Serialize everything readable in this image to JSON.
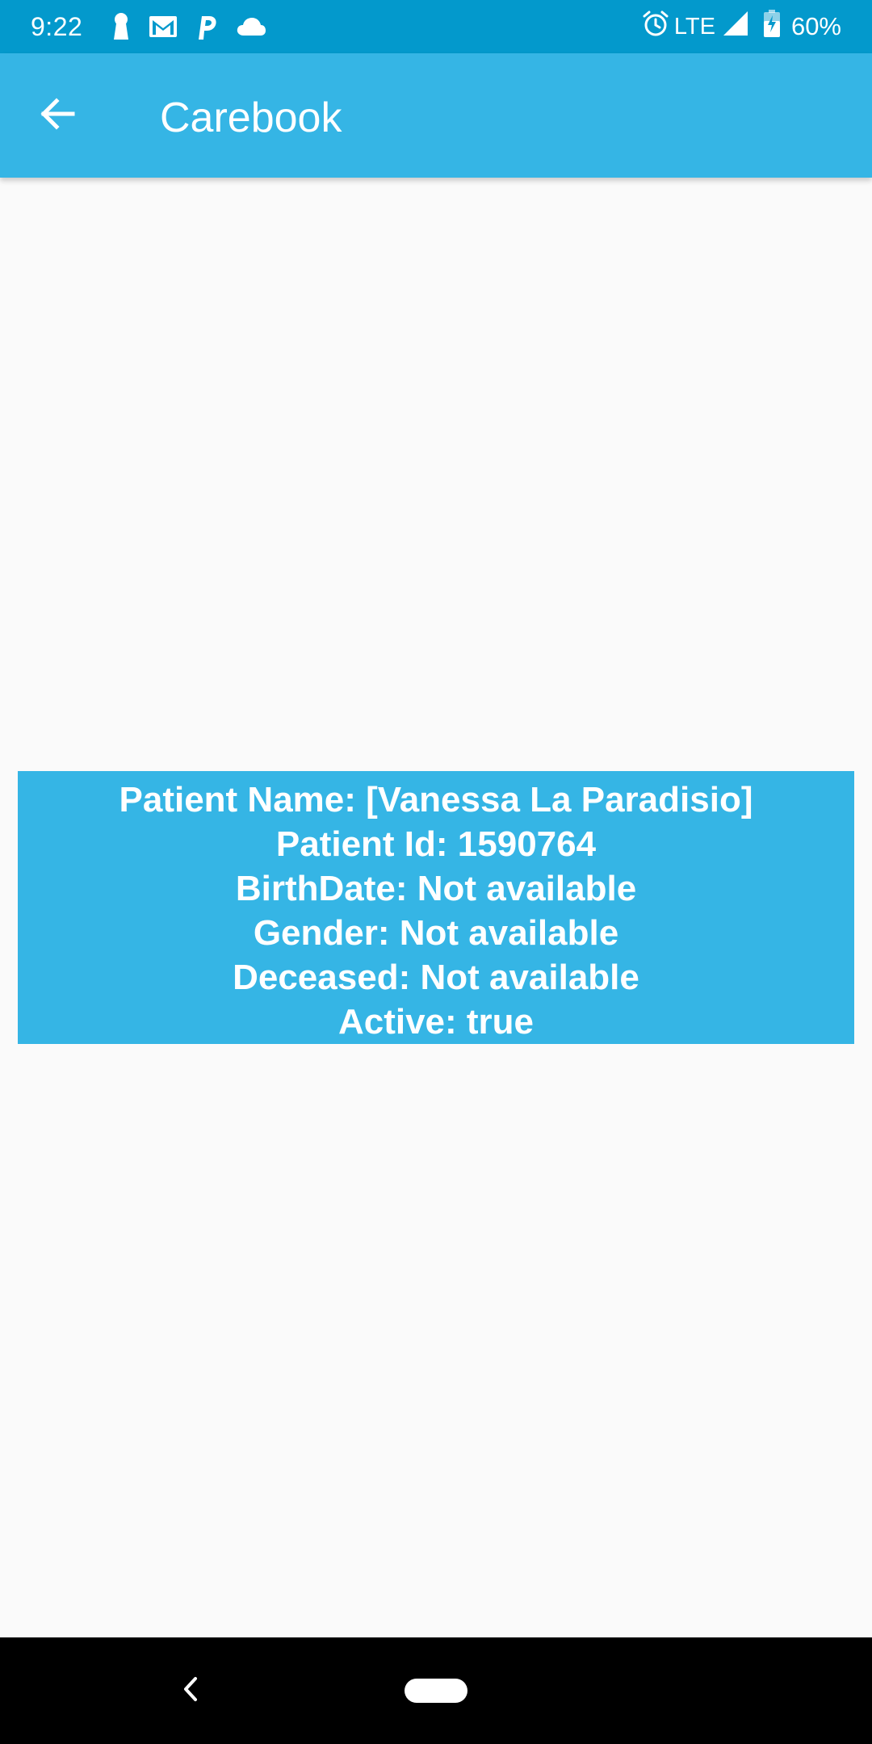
{
  "status_bar": {
    "time": "9:22",
    "network": "LTE",
    "battery": "60%",
    "left_icons": [
      "keyhole-icon",
      "gmail-icon",
      "p-icon",
      "cloud-icon"
    ],
    "right_icons": [
      "alarm-icon",
      "signal-icon",
      "battery-icon"
    ]
  },
  "app_bar": {
    "title": "Carebook",
    "back_icon": "arrow-back-icon"
  },
  "patient": {
    "name_line": "Patient Name: [Vanessa La Paradisio]",
    "id_line": "Patient Id: 1590764",
    "birthdate_line": "BirthDate: Not available",
    "gender_line": "Gender: Not available",
    "deceased_line": "Deceased: Not available",
    "active_line": "Active: true"
  },
  "colors": {
    "status_bar": "#0399cc",
    "app_bar": "#35b5e5",
    "card": "#35b5e5",
    "background": "#fafafa",
    "nav_bar": "#000000"
  }
}
